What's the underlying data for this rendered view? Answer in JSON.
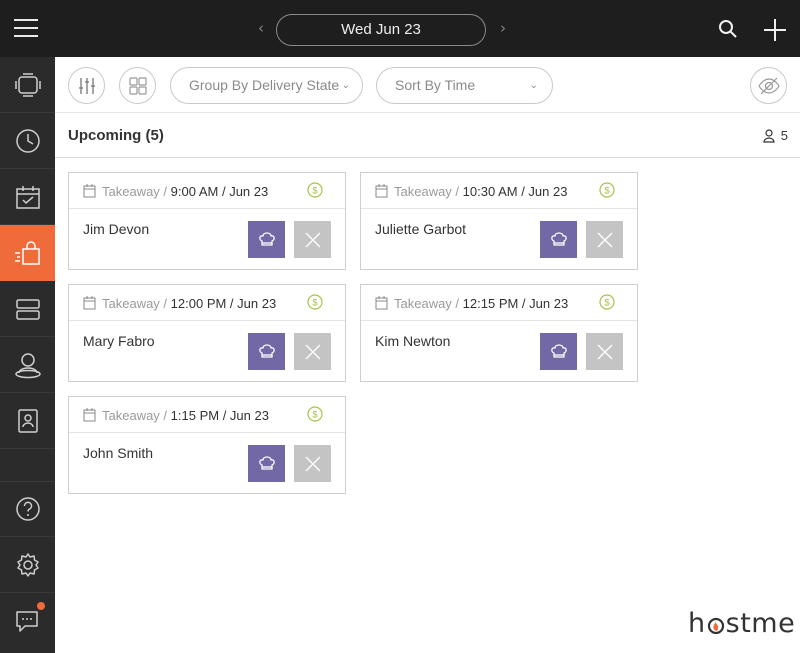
{
  "header": {
    "date": "Wed Jun 23",
    "prev_label": "‹",
    "next_label": "›"
  },
  "toolbar": {
    "group_by": "Group By Delivery State",
    "sort_by": "Sort By Time"
  },
  "section": {
    "title": "Upcoming (5)",
    "guest_count": "5"
  },
  "orders": [
    {
      "type": "Takeaway /",
      "time": "9:00 AM / Jun 23",
      "name": "Jim Devon"
    },
    {
      "type": "Takeaway /",
      "time": "10:30 AM / Jun 23",
      "name": "Juliette Garbot"
    },
    {
      "type": "Takeaway /",
      "time": "12:00 PM / Jun 23",
      "name": "Mary Fabro"
    },
    {
      "type": "Takeaway /",
      "time": "12:15 PM / Jun 23",
      "name": "Kim Newton"
    },
    {
      "type": "Takeaway /",
      "time": "1:15 PM / Jun 23",
      "name": "John Smith"
    }
  ],
  "brand": {
    "logo_prefix": "h",
    "logo_suffix": "stme",
    "accent_color": "#ef6b3a",
    "cook_button_color": "#7368a6"
  },
  "icons": {
    "sidebar": [
      "tablet-icon",
      "clock-icon",
      "calendar-icon",
      "takeaway-bag-icon",
      "server-rows-icon",
      "guest-icon",
      "contact-book-icon",
      "help-icon",
      "settings-icon",
      "chat-icon"
    ],
    "toolbar": [
      "filter-sliders-icon",
      "grid-view-icon",
      "hide-eye-icon"
    ]
  }
}
